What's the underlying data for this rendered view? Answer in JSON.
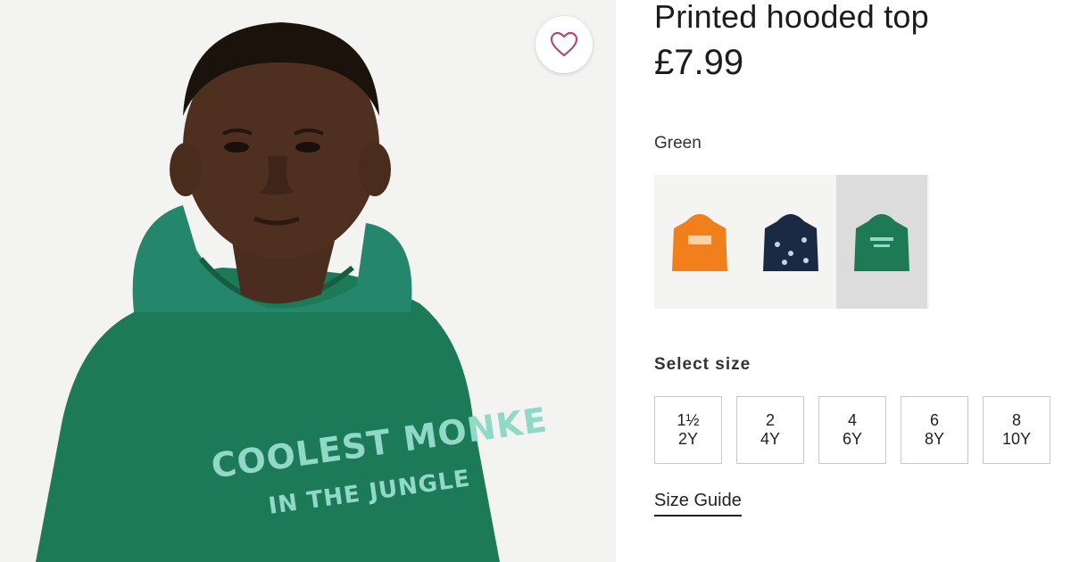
{
  "product": {
    "title": "Printed hooded top",
    "price": "£7.99",
    "print_line1": "COOLEST MONKE",
    "print_line2": "IN THE JUNGLE",
    "favourite_icon": "heart-icon"
  },
  "colour": {
    "label": "Green",
    "swatches": [
      {
        "name": "orange",
        "color": "#f07f1c",
        "selected": false
      },
      {
        "name": "navy",
        "color": "#1b2a44",
        "selected": false
      },
      {
        "name": "green",
        "color": "#1e7a55",
        "selected": true
      }
    ]
  },
  "size": {
    "label": "Select size",
    "options": [
      {
        "top": "1½",
        "bottom": "2Y"
      },
      {
        "top": "2",
        "bottom": "4Y"
      },
      {
        "top": "4",
        "bottom": "6Y"
      },
      {
        "top": "6",
        "bottom": "8Y"
      },
      {
        "top": "8",
        "bottom": "10Y"
      }
    ],
    "guide_link": "Size Guide"
  }
}
